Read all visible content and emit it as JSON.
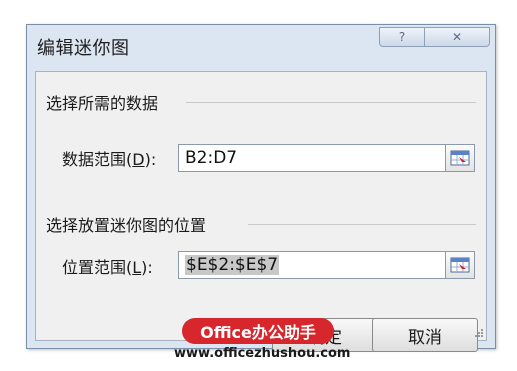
{
  "dialog": {
    "title": "编辑迷你图",
    "help_symbol": "?",
    "close_symbol": "✕"
  },
  "data_section": {
    "heading": "选择所需的数据",
    "label_prefix": "数据范围(",
    "label_access_key": "D",
    "label_suffix": "):",
    "value": "B2:D7"
  },
  "location_section": {
    "heading": "选择放置迷你图的位置",
    "label_prefix": "位置范围(",
    "label_access_key": "L",
    "label_suffix": "):",
    "value": "$E$2:$E$7"
  },
  "buttons": {
    "ok": "确定",
    "cancel": "取消"
  },
  "watermark": {
    "logo_text": "Office办公助手",
    "url": "www.officezhushou.com"
  },
  "colors": {
    "dialog_frame": "#dce6f2",
    "client_bg": "#f0f0f0",
    "watermark_red": "#d8262d"
  }
}
